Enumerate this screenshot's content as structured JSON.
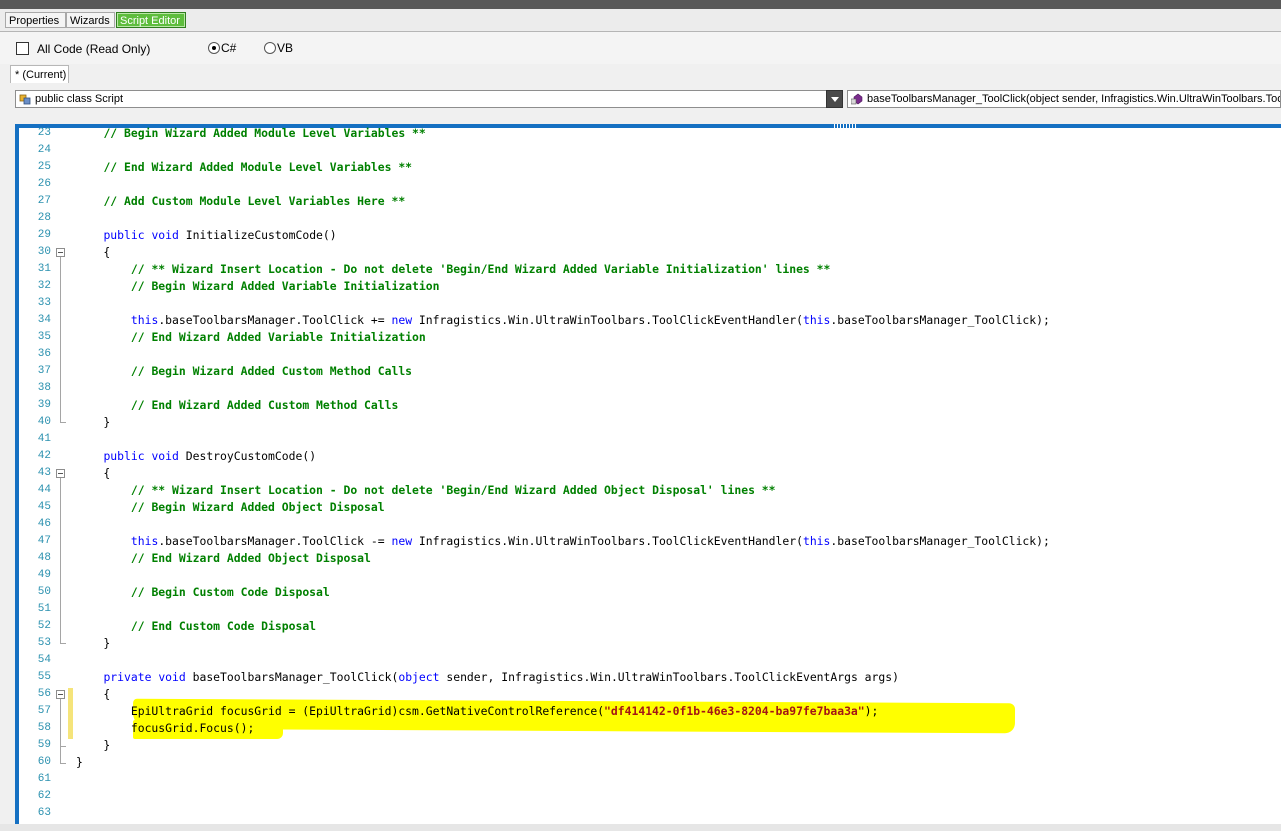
{
  "tabs": [
    {
      "label": "Properties",
      "active": false
    },
    {
      "label": "Wizards",
      "active": false
    },
    {
      "label": "Script Editor",
      "active": true
    }
  ],
  "options": {
    "all_code_label": "All Code (Read Only)",
    "all_code_checked": false,
    "lang_csharp": "C#",
    "lang_vb": "VB",
    "selected_language": "C#"
  },
  "current_tab_label": "* (Current)",
  "class_combo": {
    "value": "public class Script"
  },
  "member_combo": {
    "value": "baseToolbarsManager_ToolClick(object sender, Infragistics.Win.UltraWinToolbars.ToolClickEventArgs args)"
  },
  "colors": {
    "accent": "#1570c2",
    "active_tab": "#5ebd3d",
    "highlight": "#ffff00",
    "comment": "#008000",
    "keyword": "#0000ff",
    "string": "#a31515"
  },
  "code_lines": [
    {
      "n": "23",
      "text": "    // Begin Wizard Added Module Level Variables **"
    },
    {
      "n": "24",
      "text": ""
    },
    {
      "n": "25",
      "text": "    // End Wizard Added Module Level Variables **"
    },
    {
      "n": "26",
      "text": ""
    },
    {
      "n": "27",
      "text": "    // Add Custom Module Level Variables Here **"
    },
    {
      "n": "28",
      "text": ""
    },
    {
      "n": "29",
      "text": "    public void InitializeCustomCode()"
    },
    {
      "n": "30",
      "text": "    {"
    },
    {
      "n": "31",
      "text": "        // ** Wizard Insert Location - Do not delete 'Begin/End Wizard Added Variable Initialization' lines **"
    },
    {
      "n": "32",
      "text": "        // Begin Wizard Added Variable Initialization"
    },
    {
      "n": "33",
      "text": ""
    },
    {
      "n": "34",
      "text": "        this.baseToolbarsManager.ToolClick += new Infragistics.Win.UltraWinToolbars.ToolClickEventHandler(this.baseToolbarsManager_ToolClick);"
    },
    {
      "n": "35",
      "text": "        // End Wizard Added Variable Initialization"
    },
    {
      "n": "36",
      "text": ""
    },
    {
      "n": "37",
      "text": "        // Begin Wizard Added Custom Method Calls"
    },
    {
      "n": "38",
      "text": ""
    },
    {
      "n": "39",
      "text": "        // End Wizard Added Custom Method Calls"
    },
    {
      "n": "40",
      "text": "    }"
    },
    {
      "n": "41",
      "text": ""
    },
    {
      "n": "42",
      "text": "    public void DestroyCustomCode()"
    },
    {
      "n": "43",
      "text": "    {"
    },
    {
      "n": "44",
      "text": "        // ** Wizard Insert Location - Do not delete 'Begin/End Wizard Added Object Disposal' lines **"
    },
    {
      "n": "45",
      "text": "        // Begin Wizard Added Object Disposal"
    },
    {
      "n": "46",
      "text": ""
    },
    {
      "n": "47",
      "text": "        this.baseToolbarsManager.ToolClick -= new Infragistics.Win.UltraWinToolbars.ToolClickEventHandler(this.baseToolbarsManager_ToolClick);"
    },
    {
      "n": "48",
      "text": "        // End Wizard Added Object Disposal"
    },
    {
      "n": "49",
      "text": ""
    },
    {
      "n": "50",
      "text": "        // Begin Custom Code Disposal"
    },
    {
      "n": "51",
      "text": ""
    },
    {
      "n": "52",
      "text": "        // End Custom Code Disposal"
    },
    {
      "n": "53",
      "text": "    }"
    },
    {
      "n": "54",
      "text": ""
    },
    {
      "n": "55",
      "text": "    private void baseToolbarsManager_ToolClick(object sender, Infragistics.Win.UltraWinToolbars.ToolClickEventArgs args)"
    },
    {
      "n": "56",
      "text": "    {"
    },
    {
      "n": "57",
      "text": "        EpiUltraGrid focusGrid = (EpiUltraGrid)csm.GetNativeControlReference(\"df414142-0f1b-46e3-8204-ba97fe7baa3a\");"
    },
    {
      "n": "58",
      "text": "        focusGrid.Focus();"
    },
    {
      "n": "59",
      "text": "    }"
    },
    {
      "n": "60",
      "text": "}"
    },
    {
      "n": "61",
      "text": ""
    },
    {
      "n": "62",
      "text": ""
    },
    {
      "n": "63",
      "text": ""
    }
  ]
}
